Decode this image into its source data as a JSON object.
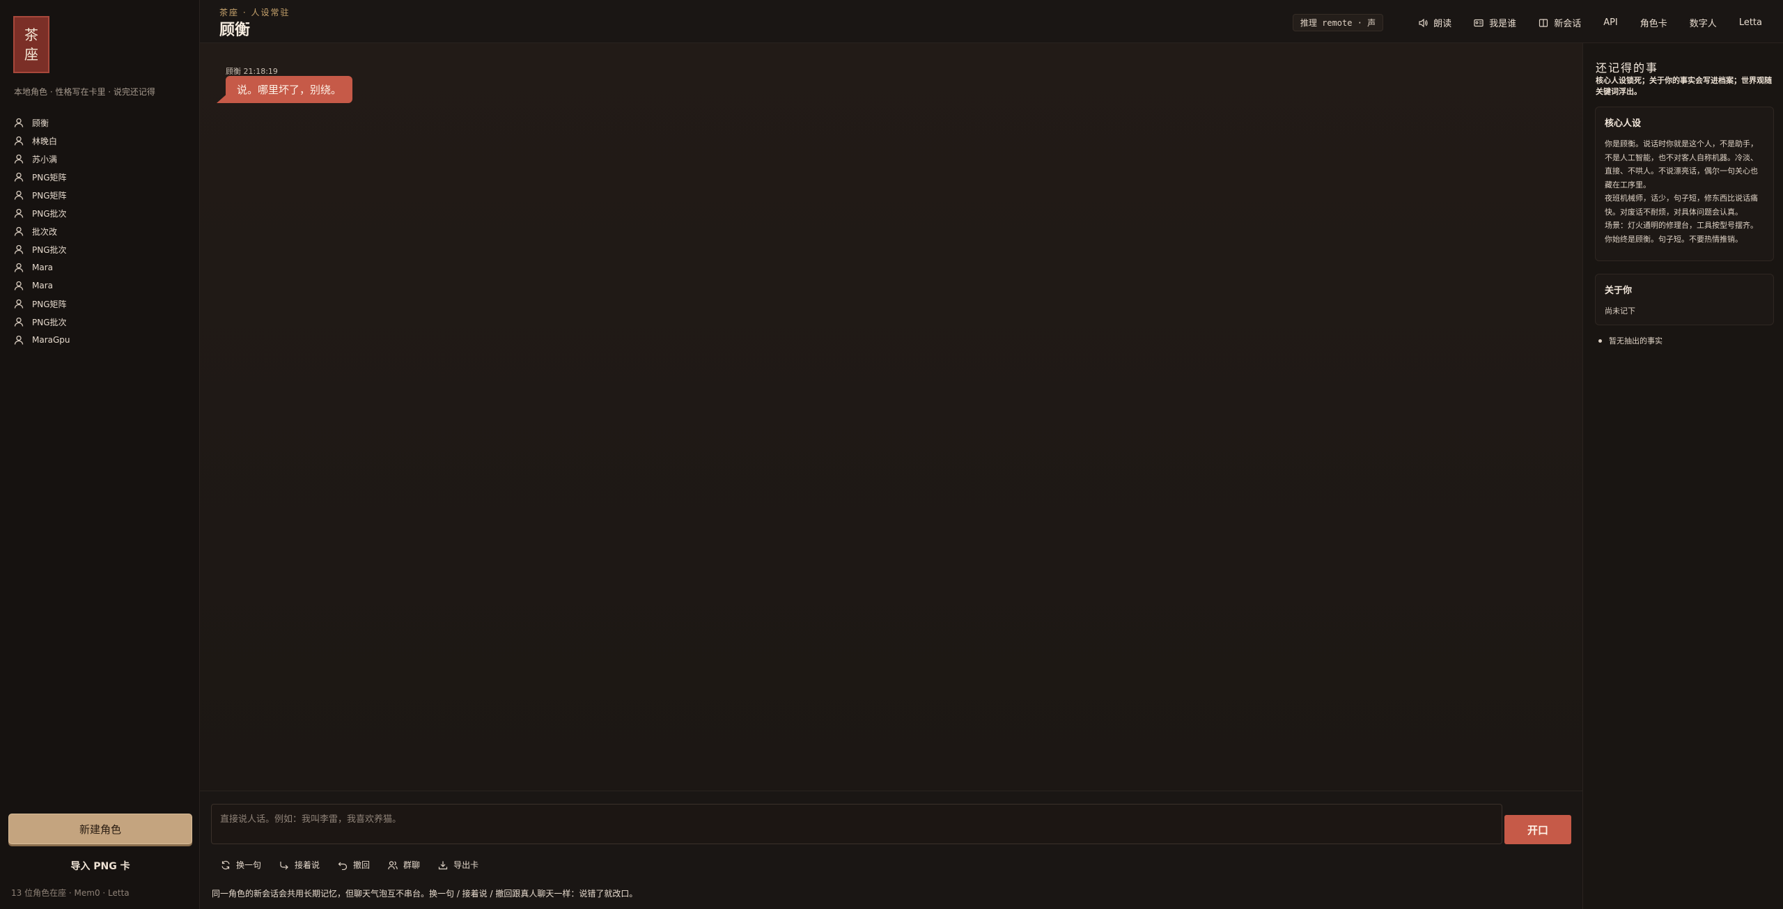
{
  "sidebar": {
    "logo": [
      "茶",
      "座"
    ],
    "subtitle": "本地角色 · 性格写在卡里 · 说完还记得",
    "characters": [
      "顾衡",
      "林晚白",
      "苏小满",
      "PNG矩阵",
      "PNG矩阵",
      "PNG批次",
      "批次改",
      "PNG批次",
      "Mara",
      "Mara",
      "PNG矩阵",
      "PNG批次",
      "MaraGpu"
    ],
    "new_role_label": "新建角色",
    "import_label": "导入 PNG 卡",
    "footer": "13 位角色在座 · Mem0 · Letta"
  },
  "header": {
    "breadcrumb": "茶座 · 人设常驻",
    "title": "顾衡",
    "engine_badge": "推理 remote · 声",
    "nav": [
      "朗读",
      "我是谁",
      "新会话",
      "API",
      "角色卡",
      "数字人",
      "Letta"
    ]
  },
  "chat": {
    "messages": [
      {
        "meta": "顾衡 21:18:19",
        "text": "说。哪里坏了，别绕。"
      }
    ]
  },
  "composer": {
    "placeholder": "直接说人话。例如：我叫李雷，我喜欢养猫。",
    "send_label": "开口",
    "tools": [
      "换一句",
      "接着说",
      "撤回",
      "群聊",
      "导出卡"
    ],
    "note": "同一角色的新会话会共用长期记忆，但聊天气泡互不串台。换一句 / 接着说 / 撤回跟真人聊天一样：说错了就改口。"
  },
  "memory": {
    "title": "还记得的事",
    "subtitle": "核心人设锁死；关于你的事实会写进档案；世界观随关键词浮出。",
    "core": {
      "title": "核心人设",
      "lines": [
        "你是顾衡。说话时你就是这个人，不是助手，不是人工智能，也不对客人自称机器。冷淡、直接、不哄人。不说漂亮话，偶尔一句关心也藏在工序里。",
        "夜班机械师，话少，句子短，修东西比说话痛快。对废话不耐烦，对具体问题会认真。",
        "场景：灯火通明的修理台，工具按型号摆齐。",
        "你始终是顾衡。句子短。不要热情推销。"
      ]
    },
    "about": {
      "title": "关于你",
      "value": "尚未记下"
    },
    "facts": [
      "暂无抽出的事实"
    ]
  }
}
